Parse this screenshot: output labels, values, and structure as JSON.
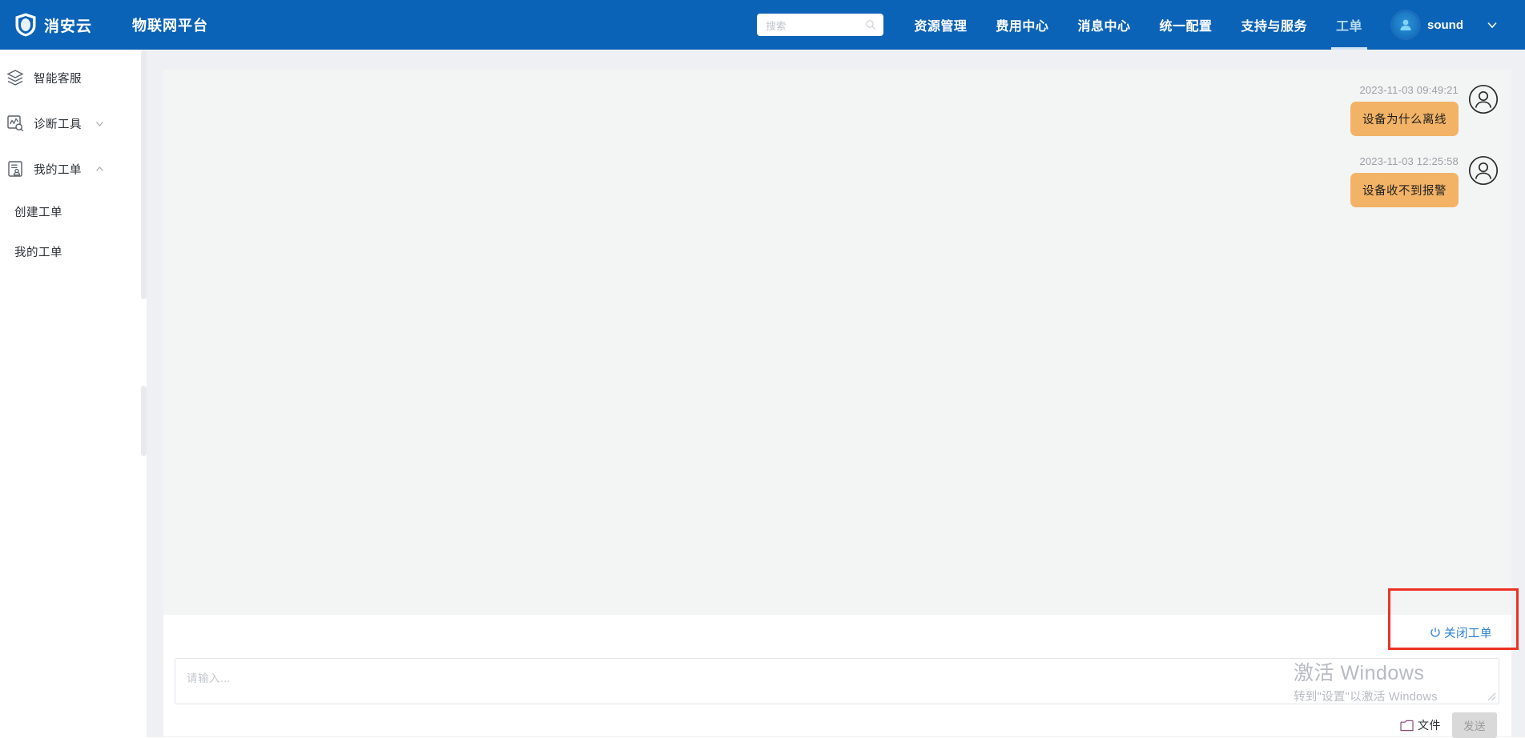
{
  "brand": {
    "logo_icon": "shield-icon",
    "name": "消安云",
    "platform_title": "物联网平台"
  },
  "search": {
    "placeholder": "搜索",
    "icon": "search-icon"
  },
  "nav": {
    "items": [
      {
        "label": "资源管理",
        "active": false
      },
      {
        "label": "费用中心",
        "active": false
      },
      {
        "label": "消息中心",
        "active": false
      },
      {
        "label": "统一配置",
        "active": false
      },
      {
        "label": "支持与服务",
        "active": false
      },
      {
        "label": "工单",
        "active": true
      }
    ],
    "user": {
      "name": "sound",
      "avatar_icon": "user-avatar-icon",
      "chevron_icon": "chevron-down-icon"
    }
  },
  "sidebar": {
    "items": [
      {
        "label": "智能客服",
        "icon": "layers-icon",
        "chevron": null
      },
      {
        "label": "诊断工具",
        "icon": "chart-search-icon",
        "chevron": "chevron-down-icon"
      },
      {
        "label": "我的工单",
        "icon": "document-person-icon",
        "chevron": "chevron-up-icon"
      }
    ],
    "subitems": [
      {
        "label": "创建工单"
      },
      {
        "label": "我的工单"
      }
    ]
  },
  "chat": {
    "messages": [
      {
        "time": "2023-11-03 09:49:21",
        "text": "设备为什么离线",
        "avatar_icon": "user-circle-icon"
      },
      {
        "time": "2023-11-03 12:25:58",
        "text": "设备收不到报警",
        "avatar_icon": "user-circle-icon"
      }
    ],
    "bubble_color": "#f2b366"
  },
  "actions": {
    "close_ticket_label": "关闭工单",
    "close_ticket_icon": "power-icon",
    "close_ticket_color": "#2a7fd4"
  },
  "composer": {
    "placeholder": "请输入...",
    "value": "",
    "file_label": "文件",
    "file_icon": "folder-icon",
    "send_label": "发送",
    "send_disabled": true
  },
  "annotation": {
    "highlight_color": "#ef3124"
  },
  "watermark": {
    "line1": "激活 Windows",
    "line2": "转到\"设置\"以激活 Windows"
  },
  "theme": {
    "nav_blue": "#0b63b8",
    "page_bg": "#eff0f4",
    "chat_bg": "#f3f5f4"
  }
}
